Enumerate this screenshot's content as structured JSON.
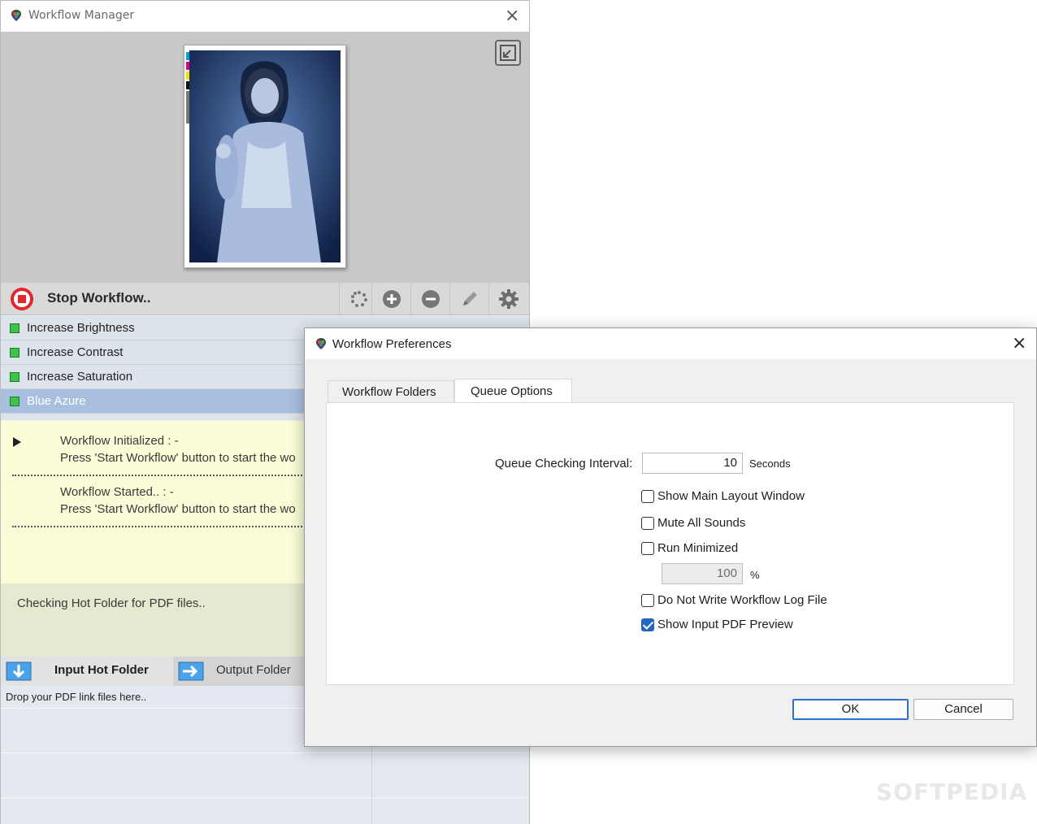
{
  "manager": {
    "title": "Workflow Manager",
    "toolbar": {
      "stop_label": "Stop Workflow.."
    },
    "steps": [
      "Increase Brightness",
      "Increase Contrast",
      "Increase Saturation",
      "Blue Azure"
    ],
    "log": [
      {
        "title": "Workflow Initialized  :   -",
        "message": "Press 'Start Workflow' button to start the wo"
      },
      {
        "title": "Workflow Started..   :   -",
        "message": "Press 'Start Workflow' button to start the wo"
      }
    ],
    "status": "Checking Hot Folder for PDF files..",
    "folder_tabs": {
      "input": "Input Hot Folder",
      "output": "Output Folder"
    },
    "drop_hint": "Drop your PDF link files here.."
  },
  "preferences": {
    "title": "Workflow Preferences",
    "tabs": {
      "folders": "Workflow Folders",
      "queue": "Queue Options"
    },
    "interval": {
      "label": "Queue Checking Interval:",
      "value": "10",
      "unit": "Seconds"
    },
    "options": {
      "show_main_layout": "Show Main Layout Window",
      "mute_sounds": "Mute All Sounds",
      "run_minimized": "Run Minimized",
      "minimized_value": "100",
      "minimized_unit": "%",
      "no_log": "Do Not Write Workflow Log File",
      "show_preview": "Show Input PDF Preview"
    },
    "buttons": {
      "ok": "OK",
      "cancel": "Cancel"
    }
  },
  "watermark": "SOFTPEDIA",
  "colors": {
    "accent": "#1f66c7",
    "selected_step": "#a9bfe0",
    "log_bg": "#fcfcd9",
    "stop_red": "#e3262e"
  }
}
